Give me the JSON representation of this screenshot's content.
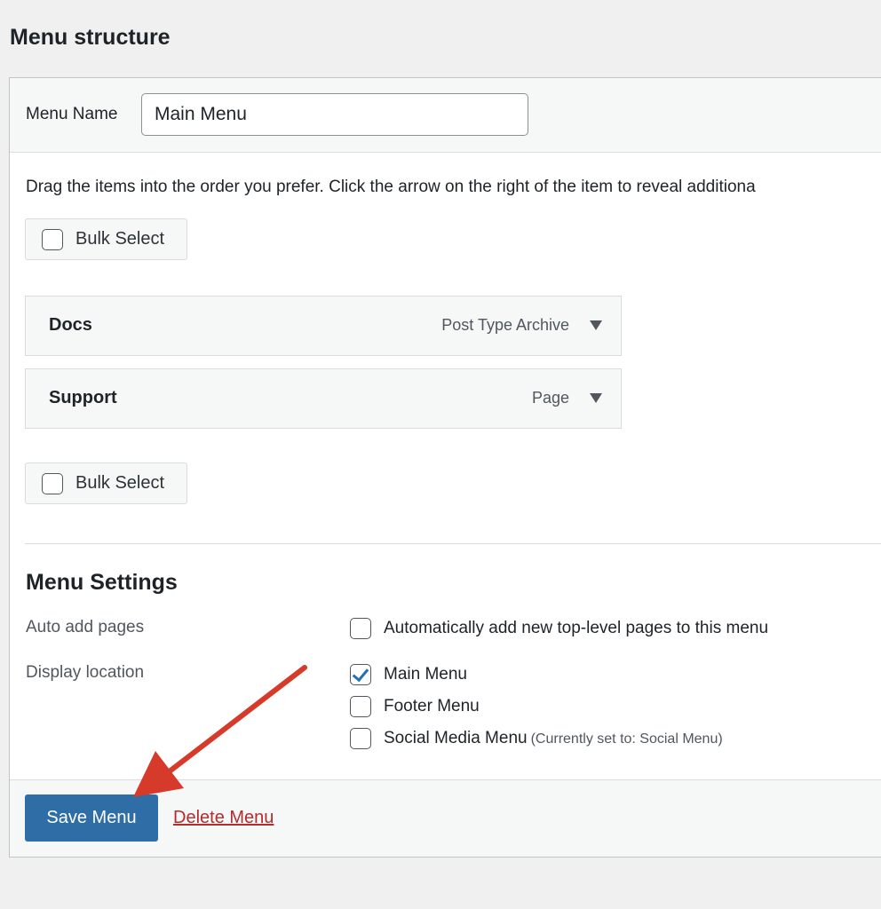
{
  "page": {
    "heading": "Menu structure"
  },
  "menu_name": {
    "label": "Menu Name",
    "value": "Main Menu"
  },
  "instructions": "Drag the items into the order you prefer. Click the arrow on the right of the item to reveal additiona",
  "bulk_select": {
    "label": "Bulk Select",
    "checked": false
  },
  "menu_items": [
    {
      "title": "Docs",
      "type": "Post Type Archive"
    },
    {
      "title": "Support",
      "type": "Page"
    }
  ],
  "settings": {
    "title": "Menu Settings",
    "auto_add": {
      "label": "Auto add pages",
      "option": "Automatically add new top-level pages to this menu",
      "checked": false
    },
    "display_location": {
      "label": "Display location",
      "options": [
        {
          "label": "Main Menu",
          "note": "",
          "checked": true
        },
        {
          "label": "Footer Menu",
          "note": "",
          "checked": false
        },
        {
          "label": "Social Media Menu",
          "note": "(Currently set to: Social Menu)",
          "checked": false
        }
      ]
    }
  },
  "actions": {
    "save": "Save Menu",
    "delete": "Delete Menu"
  },
  "colors": {
    "primary_button": "#2e6da6",
    "delete_link": "#b32d2e",
    "annotation_arrow": "#d63a2a",
    "checkmark": "#2271b1"
  },
  "icons": {
    "item_toggle": "triangle-down-icon",
    "checked": "checkmark-icon",
    "annotation": "red-arrow-icon"
  }
}
